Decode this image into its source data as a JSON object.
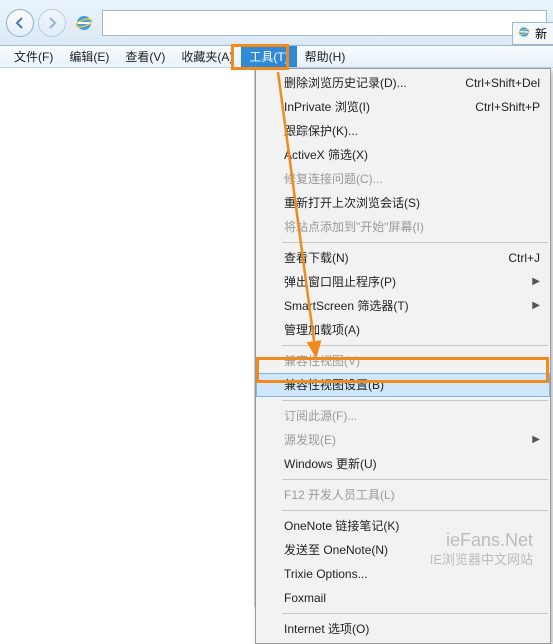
{
  "tab": {
    "label": "新"
  },
  "menubar": {
    "items": [
      {
        "label": "文件(F)"
      },
      {
        "label": "编辑(E)"
      },
      {
        "label": "查看(V)"
      },
      {
        "label": "收藏夹(A)"
      },
      {
        "label": "工具(T)"
      },
      {
        "label": "帮助(H)"
      }
    ]
  },
  "dropdown": {
    "groups": [
      [
        {
          "label": "删除浏览历史记录(D)...",
          "shortcut": "Ctrl+Shift+Del"
        },
        {
          "label": "InPrivate 浏览(I)",
          "shortcut": "Ctrl+Shift+P"
        },
        {
          "label": "跟踪保护(K)..."
        },
        {
          "label": "ActiveX 筛选(X)"
        },
        {
          "label": "修复连接问题(C)...",
          "disabled": true
        },
        {
          "label": "重新打开上次浏览会话(S)"
        },
        {
          "label": "将站点添加到\"开始\"屏幕(I)",
          "disabled": true
        }
      ],
      [
        {
          "label": "查看下载(N)",
          "shortcut": "Ctrl+J"
        },
        {
          "label": "弹出窗口阻止程序(P)",
          "submenu": true
        },
        {
          "label": "SmartScreen 筛选器(T)",
          "submenu": true
        },
        {
          "label": "管理加载项(A)"
        }
      ],
      [
        {
          "label": "兼容性视图(V)",
          "disabled": true
        },
        {
          "label": "兼容性视图设置(B)",
          "highlighted": true
        }
      ],
      [
        {
          "label": "订阅此源(F)...",
          "disabled": true
        },
        {
          "label": "源发现(E)",
          "disabled": true,
          "submenu": true
        },
        {
          "label": "Windows 更新(U)"
        }
      ],
      [
        {
          "label": "F12 开发人员工具(L)",
          "disabled": true
        }
      ],
      [
        {
          "label": "OneNote 链接笔记(K)"
        },
        {
          "label": "发送至 OneNote(N)"
        },
        {
          "label": "Trixie Options..."
        },
        {
          "label": "Foxmail"
        }
      ],
      [
        {
          "label": "Internet 选项(O)"
        }
      ]
    ]
  },
  "watermark": {
    "main": "ieFans.Net",
    "sub": "IE浏览器中文网站"
  }
}
